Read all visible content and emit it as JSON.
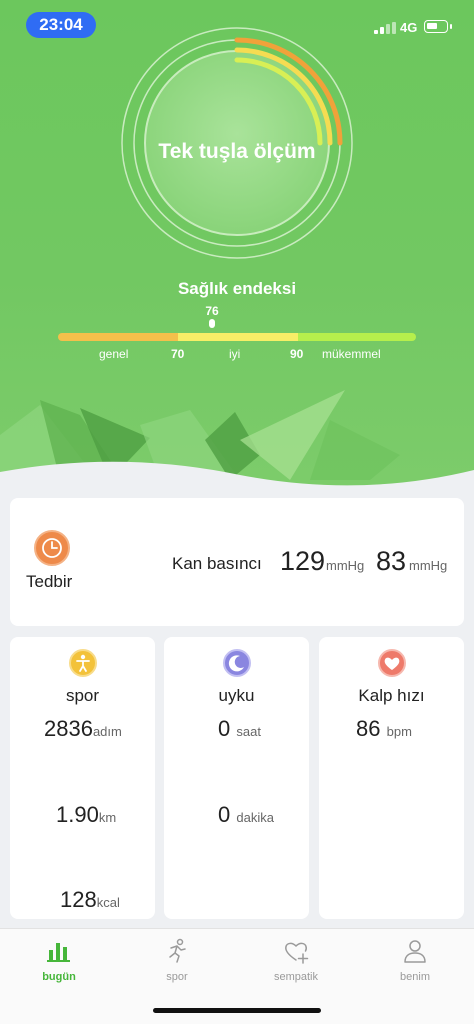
{
  "status_bar": {
    "time": "23:04",
    "network": "4G"
  },
  "hero": {
    "measure_label": "Tek tuşla ölçüm",
    "health_index_title": "Sağlık endeksi",
    "health_index_value": "76",
    "scale": {
      "low_label": "genel",
      "mid_label": "iyi",
      "high_label": "mükemmel",
      "threshold_1": "70",
      "threshold_2": "90"
    }
  },
  "blood_pressure": {
    "action_label": "Tedbir",
    "title": "Kan basıncı",
    "systolic": "129",
    "systolic_unit": "mmHg",
    "diastolic": "83",
    "diastolic_unit": "mmHg"
  },
  "cards": {
    "sport": {
      "title": "spor",
      "steps": "2836",
      "steps_unit": "adım",
      "distance": "1.90",
      "distance_unit": "km",
      "calories": "128",
      "calories_unit": "kcal"
    },
    "sleep": {
      "title": "uyku",
      "hours": "0",
      "hours_unit": "saat",
      "minutes": "0",
      "minutes_unit": "dakika"
    },
    "heart": {
      "title": "Kalp hızı",
      "bpm": "86",
      "bpm_unit": "bpm"
    }
  },
  "tabbar": {
    "tabs": [
      {
        "label": "bugün",
        "icon": "bar-chart-icon",
        "active": true
      },
      {
        "label": "spor",
        "icon": "running-icon",
        "active": false
      },
      {
        "label": "sempatik",
        "icon": "heart-plus-icon",
        "active": false
      },
      {
        "label": "benim",
        "icon": "person-icon",
        "active": false
      }
    ]
  },
  "colors": {
    "accent_green": "#46b63a",
    "hero_green": "#6cc75d",
    "orange": "#ee8a4a"
  }
}
